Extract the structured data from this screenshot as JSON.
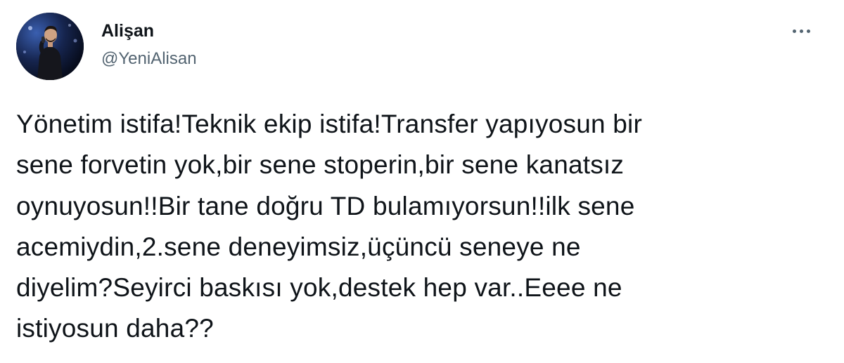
{
  "tweet": {
    "author": {
      "display_name": "Alişan",
      "handle": "@YeniAlisan",
      "avatar_icon": "profile-photo"
    },
    "more_icon": "more-options-icon",
    "text_lines": [
      "Yönetim istifa!Teknik ekip istifa!Transfer yapıyosun bir",
      "sene forvetin yok,bir sene stoperin,bir sene kanatsız",
      "oynuyosun!!Bir tane doğru TD bulamıyorsun!!ilk sene",
      "acemiydin,2.sene deneyimsiz,üçüncü seneye ne",
      "diyelim?Seyirci baskısı yok,destek hep var..Eeee ne",
      "istiyosun daha??"
    ]
  },
  "colors": {
    "primary_text": "#0f1419",
    "secondary_text": "#536471",
    "background": "#ffffff"
  }
}
